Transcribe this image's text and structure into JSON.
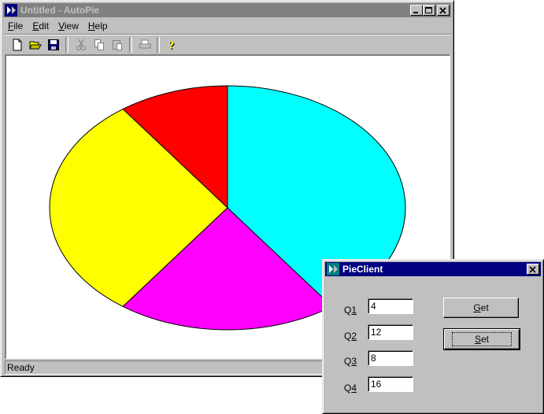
{
  "main_window": {
    "title": "Untitled - AutoPie",
    "menu": [
      {
        "accel": "F",
        "rest": "ile"
      },
      {
        "accel": "E",
        "rest": "dit"
      },
      {
        "accel": "V",
        "rest": "iew"
      },
      {
        "accel": "H",
        "rest": "elp"
      }
    ],
    "toolbar_icons": [
      "new-file-icon",
      "open-folder-icon",
      "save-icon",
      "cut-icon",
      "copy-icon",
      "paste-icon",
      "print-icon",
      "help-icon"
    ],
    "status": "Ready"
  },
  "chart_data": {
    "type": "pie",
    "categories": [
      "Q1",
      "Q2",
      "Q3",
      "Q4"
    ],
    "values": [
      4,
      12,
      8,
      16
    ],
    "colors": [
      "#ff0000",
      "#ffff00",
      "#ff00ff",
      "#00ffff"
    ],
    "start": "top, counter-clockwise"
  },
  "pie_client": {
    "title": "PieClient",
    "fields": [
      {
        "accel": "1",
        "prefix": "Q",
        "value": "4"
      },
      {
        "accel": "2",
        "prefix": "Q",
        "value": "12"
      },
      {
        "accel": "3",
        "prefix": "Q",
        "value": "8"
      },
      {
        "accel": "4",
        "prefix": "Q",
        "value": "16"
      }
    ],
    "get_button": {
      "accel": "G",
      "rest": "et"
    },
    "set_button": {
      "accel": "S",
      "rest": "et"
    }
  }
}
